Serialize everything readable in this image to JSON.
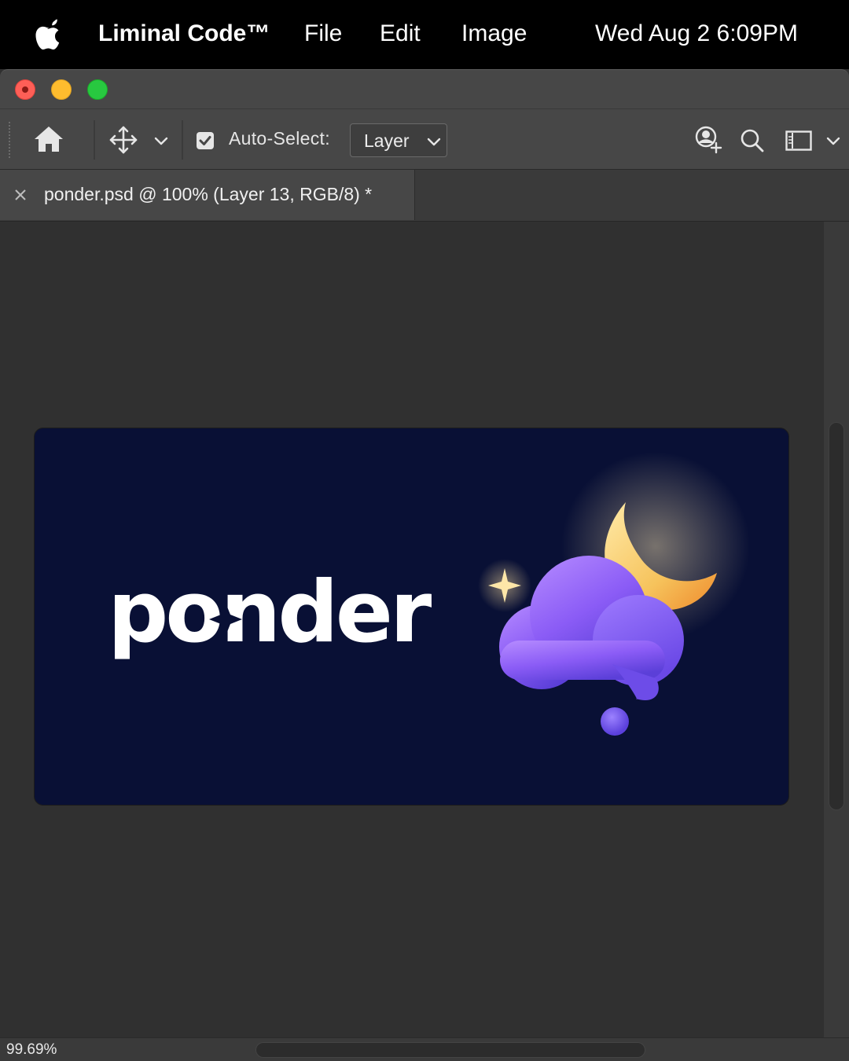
{
  "menubar": {
    "apple_icon": "apple-logo-icon",
    "app_name": "Liminal Code™",
    "items": [
      "File",
      "Edit",
      "Image"
    ],
    "clock": "Wed Aug 2 6:09PM"
  },
  "window": {
    "traffic_lights": [
      "close",
      "minimize",
      "zoom"
    ]
  },
  "toolbar": {
    "home_icon": "home-icon",
    "move_icon": "move-tool-icon",
    "auto_select_checked": true,
    "auto_select_label": "Auto-Select:",
    "auto_select_value": "Layer",
    "right_icons": [
      "user-add-icon",
      "search-icon",
      "workspace-icon"
    ]
  },
  "document": {
    "tab_title": "ponder.psd @ 100% (Layer 13, RGB/8) *",
    "artboard_text": "ponder",
    "artboard_bg": "#091035"
  },
  "status": {
    "zoom": "99.69%"
  }
}
